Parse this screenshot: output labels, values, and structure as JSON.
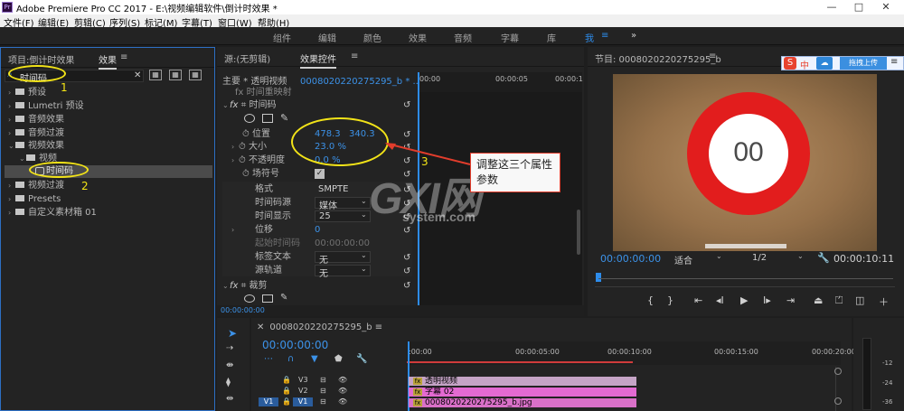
{
  "app": {
    "title": "Adobe Premiere Pro CC 2017 - E:\\视频编辑软件\\倒计时效果 *",
    "logo": "Pr",
    "window_controls": [
      "—",
      "□",
      "✕"
    ]
  },
  "menu": [
    "文件(F)",
    "编辑(E)",
    "剪辑(C)",
    "序列(S)",
    "标记(M)",
    "字幕(T)",
    "窗口(W)",
    "帮助(H)"
  ],
  "workspaces": {
    "items": [
      "组件",
      "编辑",
      "颜色",
      "效果",
      "音频",
      "字幕",
      "库",
      "我"
    ],
    "more": "≡",
    "overflow": "»"
  },
  "project_panel": {
    "tab_project": "项目:倒计时效果",
    "tab_effects": "效果",
    "menu": "≡",
    "search_value": "时间码",
    "tree": [
      {
        "label": "预设",
        "level": 0,
        "expanded": false
      },
      {
        "label": "Lumetri 预设",
        "level": 0,
        "expanded": false
      },
      {
        "label": "音频效果",
        "level": 0,
        "expanded": false
      },
      {
        "label": "音频过渡",
        "level": 0,
        "expanded": false
      },
      {
        "label": "视频效果",
        "level": 0,
        "expanded": true
      },
      {
        "label": "视频",
        "level": 1,
        "expanded": true
      },
      {
        "label": "时间码",
        "level": 2,
        "expanded": false
      },
      {
        "label": "视频过渡",
        "level": 0,
        "expanded": false
      },
      {
        "label": "Presets",
        "level": 0,
        "expanded": false
      },
      {
        "label": "自定义素材箱 01",
        "level": 0,
        "expanded": false
      }
    ]
  },
  "effect_controls": {
    "tab_source": "源:(无剪辑)",
    "tab_effects": "效果控件",
    "menu": "≡",
    "master": "主要 * 透明视频",
    "clip": "00080202202752​95_b * ...",
    "ruler": [
      "00:00",
      "00:00:05",
      "00:00:1"
    ],
    "partial_row": "时间重映射",
    "fx_name": "时间码",
    "properties": [
      {
        "name": "位置",
        "value": "478.3",
        "value2": "340.3"
      },
      {
        "name": "大小",
        "value": "23.0 %"
      },
      {
        "name": "不透明度",
        "value": "0.0 %"
      },
      {
        "name": "场符号",
        "value": "☑"
      },
      {
        "name": "格式",
        "value": "SMPTE"
      },
      {
        "name": "时间码源",
        "value": "媒体"
      },
      {
        "name": "时间显示",
        "value": "25"
      },
      {
        "name": "位移",
        "value": "0"
      },
      {
        "name": "起始时间码",
        "value": "00:00:00:00"
      },
      {
        "name": "标签文本",
        "value": "无"
      },
      {
        "name": "源轨道",
        "value": "无"
      }
    ],
    "fx2_name": "裁剪",
    "timecode": "00:00:00:00"
  },
  "program": {
    "tab": "节目: 00080202202752​95_b",
    "menu": "≡",
    "countdown": "00",
    "timecode_current": "00:00:00:00",
    "fit": "适合",
    "resolution": "1/2",
    "timecode_duration": "00:00:10:11"
  },
  "sogou": {
    "logo": "S",
    "lang": "中",
    "upload": "拖拽上传"
  },
  "callout": {
    "text": "调整这三个属性参数"
  },
  "annotations": [
    "1",
    "2",
    "3"
  ],
  "watermark": {
    "brand": "GXI网",
    "site": "system.com"
  },
  "timeline": {
    "tab": "00080202202752​95_b",
    "menu": "≡",
    "timecode": "00:00:00:00",
    "ruler": [
      ":00:00",
      "00:00:05:00",
      "00:00:10:00",
      "00:00:15:00",
      "00:00:20:00"
    ],
    "tracks": [
      {
        "src": "",
        "name": "V3"
      },
      {
        "src": "",
        "name": "V2"
      },
      {
        "src": "V1",
        "name": "V1"
      }
    ],
    "clips": [
      {
        "label": "透明视频",
        "fx": "fx",
        "color": "#c5a4c6"
      },
      {
        "label": "字幕 02",
        "fx": "fx",
        "color": "#e36ad2"
      },
      {
        "label": "000802022027529​5_b.jpg",
        "fx": "fx",
        "color": "#d970c8"
      }
    ]
  },
  "meter": {
    "scale": [
      "-12",
      "-24",
      "-36"
    ]
  },
  "colors": {
    "accent": "#2d8ceb",
    "annotation": "#f2e318",
    "callout_border": "#e23d2c",
    "countdown_ring": "#e21d1d"
  }
}
